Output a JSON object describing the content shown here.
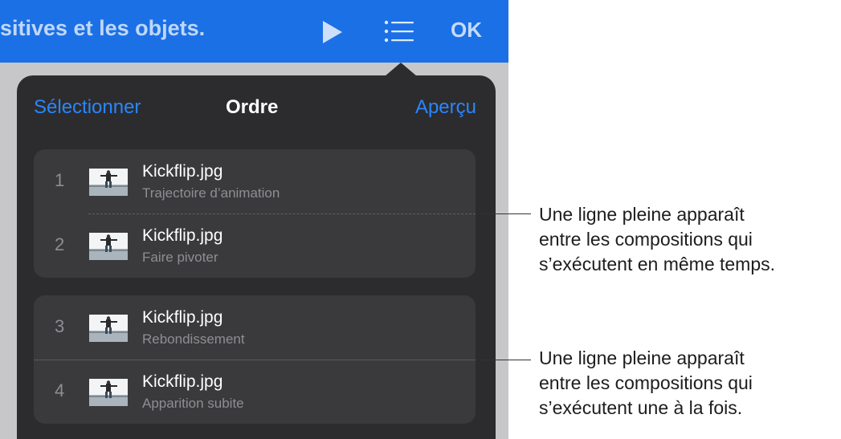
{
  "toolbar": {
    "title": "sitives et les objets.",
    "ok_label": "OK",
    "accent_color": "#1b70e6",
    "icons": [
      "play-icon",
      "list-icon"
    ]
  },
  "popover": {
    "select_label": "Sélectionner",
    "title": "Ordre",
    "preview_label": "Aperçu",
    "groups": [
      {
        "items": [
          {
            "number": "1",
            "name": "Kickflip.jpg",
            "effect": "Trajectoire d’animation"
          },
          {
            "number": "2",
            "name": "Kickflip.jpg",
            "effect": "Faire pivoter"
          }
        ]
      },
      {
        "items": [
          {
            "number": "3",
            "name": "Kickflip.jpg",
            "effect": "Rebondissement"
          },
          {
            "number": "4",
            "name": "Kickflip.jpg",
            "effect": "Apparition subite"
          }
        ]
      }
    ]
  },
  "callouts": [
    {
      "lines": [
        "Une ligne pleine apparaît",
        "entre les compositions qui",
        "s’exécutent en même temps."
      ]
    },
    {
      "lines": [
        "Une ligne pleine apparaît",
        "entre les compositions qui",
        "s’exécutent une à la fois."
      ]
    }
  ]
}
